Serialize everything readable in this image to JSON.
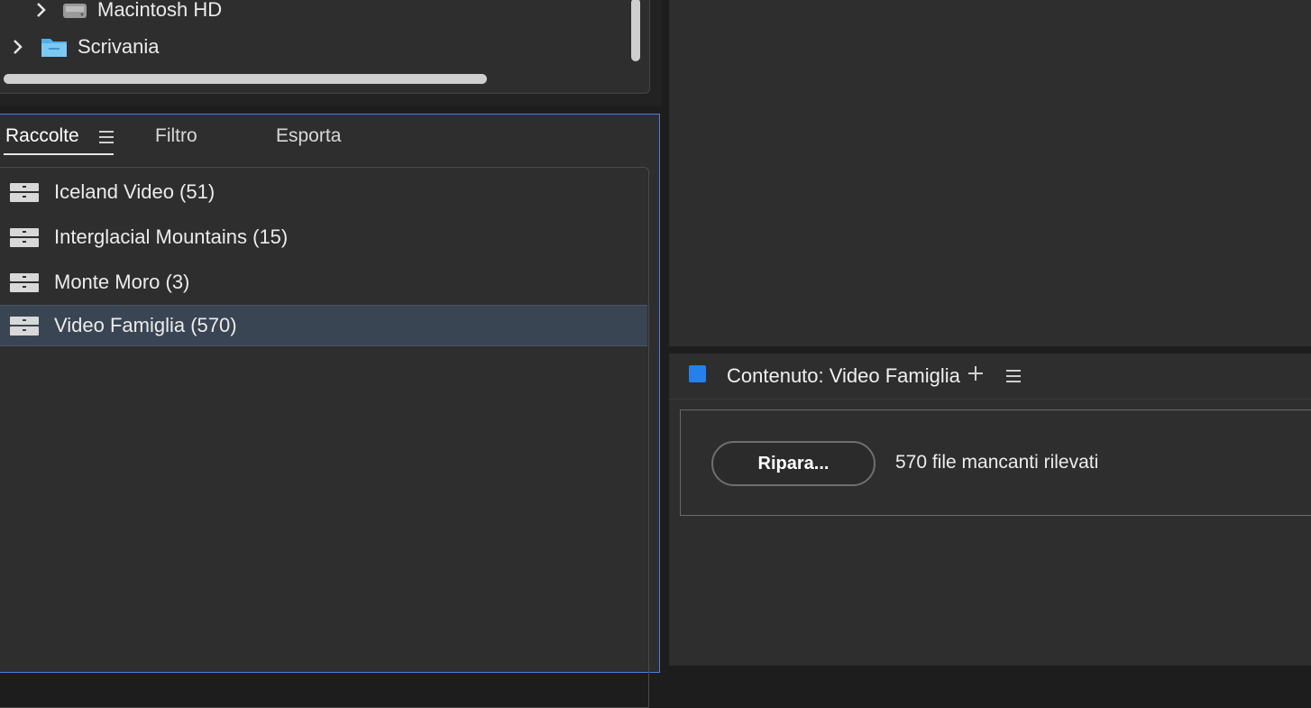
{
  "folders": {
    "items": [
      {
        "label": "Macintosh HD",
        "icon": "hard-drive-icon"
      },
      {
        "label": "Scrivania",
        "icon": "folder-icon"
      }
    ]
  },
  "collections_panel": {
    "tabs": [
      {
        "label": "Raccolte",
        "active": true
      },
      {
        "label": "Filtro",
        "active": false
      },
      {
        "label": "Esporta",
        "active": false
      }
    ],
    "items": [
      {
        "label": "Iceland Video (51)",
        "selected": false
      },
      {
        "label": "Interglacial Mountains (15)",
        "selected": false
      },
      {
        "label": "Monte Moro (3)",
        "selected": false
      },
      {
        "label": "Video Famiglia (570)",
        "selected": true
      }
    ]
  },
  "content_panel": {
    "title": "Contenuto: Video Famiglia",
    "accent_color": "#2680eb",
    "repair_button": "Ripara...",
    "status_text": "570 file mancanti rilevati"
  }
}
